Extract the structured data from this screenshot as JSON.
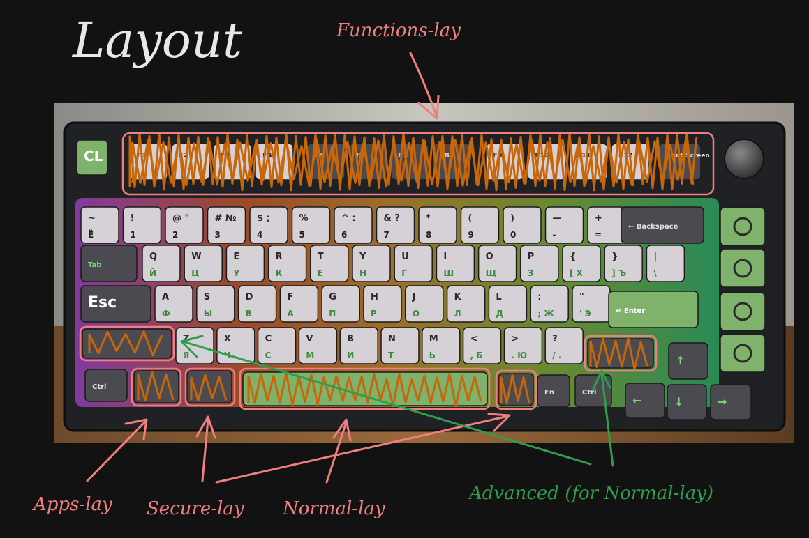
{
  "title": "Layout",
  "annotations": {
    "functions": "Functions-lay",
    "apps": "Apps-lay",
    "secure": "Secure-lay",
    "normal": "Normal-lay",
    "advanced": "Advanced (for Normal-lay)"
  },
  "keys": {
    "cl": "CL",
    "esc": "Esc",
    "f": [
      "F1",
      "F2",
      "F3",
      "F4",
      "F5",
      "F6",
      "F7",
      "F8",
      "F9",
      "F10",
      "F11",
      "F12"
    ],
    "print_screen": "Print Screen",
    "number_row": [
      {
        "top": "~",
        "bottom": "Ё"
      },
      {
        "top": "!",
        "bottom": "1"
      },
      {
        "top": "@ \"",
        "bottom": "2"
      },
      {
        "top": "# №",
        "bottom": "3"
      },
      {
        "top": "$ ;",
        "bottom": "4"
      },
      {
        "top": "%",
        "bottom": "5"
      },
      {
        "top": "^ :",
        "bottom": "6"
      },
      {
        "top": "& ?",
        "bottom": "7"
      },
      {
        "top": "*",
        "bottom": "8"
      },
      {
        "top": "(",
        "bottom": "9"
      },
      {
        "top": ")",
        "bottom": "0"
      },
      {
        "top": "—",
        "bottom": "-"
      },
      {
        "top": "+",
        "bottom": "="
      }
    ],
    "backspace": "← Backspace",
    "tab": "Tab",
    "q_row": [
      {
        "top": "Q",
        "bottom": "Й"
      },
      {
        "top": "W",
        "bottom": "Ц"
      },
      {
        "top": "E",
        "bottom": "У"
      },
      {
        "top": "R",
        "bottom": "К"
      },
      {
        "top": "T",
        "bottom": "Е"
      },
      {
        "top": "Y",
        "bottom": "Н"
      },
      {
        "top": "U",
        "bottom": "Г"
      },
      {
        "top": "I",
        "bottom": "Ш"
      },
      {
        "top": "O",
        "bottom": "Щ"
      },
      {
        "top": "P",
        "bottom": "З"
      },
      {
        "top": "{",
        "bottom": "[ Х"
      },
      {
        "top": "}",
        "bottom": "] Ъ"
      },
      {
        "top": "|",
        "bottom": "\\"
      }
    ],
    "a_row": [
      {
        "top": "A",
        "bottom": "Ф"
      },
      {
        "top": "S",
        "bottom": "Ы"
      },
      {
        "top": "D",
        "bottom": "В"
      },
      {
        "top": "F",
        "bottom": "А"
      },
      {
        "top": "G",
        "bottom": "П"
      },
      {
        "top": "H",
        "bottom": "Р"
      },
      {
        "top": "J",
        "bottom": "О"
      },
      {
        "top": "K",
        "bottom": "Л"
      },
      {
        "top": "L",
        "bottom": "Д"
      },
      {
        "top": ":",
        "bottom": "; Ж"
      },
      {
        "top": "\"",
        "bottom": "' Э"
      }
    ],
    "enter": "↵ Enter",
    "z_row": [
      {
        "top": "Z",
        "bottom": "Я"
      },
      {
        "top": "X",
        "bottom": "Ч"
      },
      {
        "top": "C",
        "bottom": "С"
      },
      {
        "top": "V",
        "bottom": "М"
      },
      {
        "top": "B",
        "bottom": "И"
      },
      {
        "top": "N",
        "bottom": "Т"
      },
      {
        "top": "M",
        "bottom": "Ь"
      },
      {
        "top": "<",
        "bottom": ", Б"
      },
      {
        "top": ">",
        "bottom": ". Ю"
      },
      {
        "top": "?",
        "bottom": "/ ."
      }
    ],
    "ctrl": "Ctrl",
    "fn": "Fn",
    "arrows": {
      "up": "↑",
      "left": "←",
      "down": "↓",
      "right": "→"
    }
  },
  "colors": {
    "background": "#121212",
    "title": "#e8e8e8",
    "salmon": "#f08080",
    "green_annotation": "#2e9e4a",
    "scribble": "#c8660a",
    "key_light": "#d5d1d6",
    "key_dark": "#4a4a50",
    "key_green": "#7fb26b",
    "legend_green": "#3f8a3f"
  }
}
